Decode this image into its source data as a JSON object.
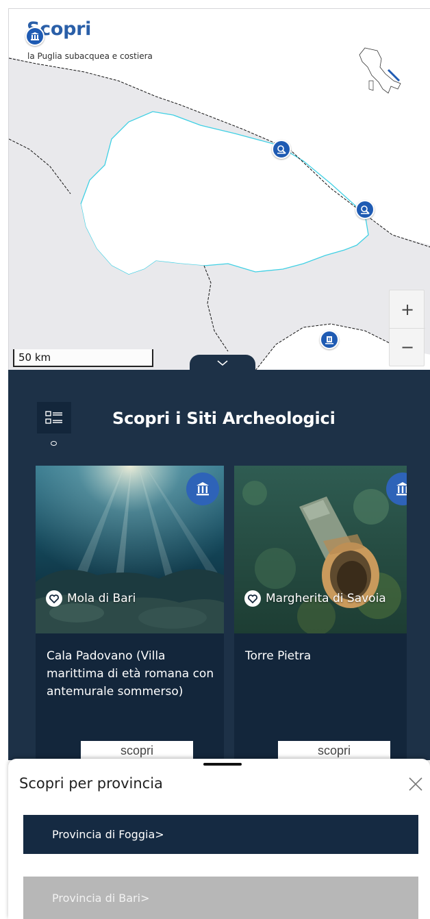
{
  "map": {
    "title": "Scopri",
    "subtitle": "la Puglia subacquea e costiera",
    "scale_label": "50 km",
    "zoom_in": "+",
    "zoom_out": "−",
    "marker_icon": "archaeology-site-icon",
    "colors": {
      "region_outline": "#3fd0e4",
      "marker": "#1f5bb3",
      "land_outside": "#e9e9ec"
    }
  },
  "panel": {
    "title": "Scopri i Siti Archeologici",
    "list_toggle_icon": "list-view-icon",
    "background": "#1d3147",
    "cards": [
      {
        "location": "Mola di Bari",
        "name": "Cala Padovano (Villa marittima di età romana con antemurale sommerso)",
        "button": "scopri",
        "badge_icon": "temple-icon"
      },
      {
        "location": "Margherita di Savoia",
        "name": "Torre Pietra",
        "button": "scopri",
        "badge_icon": "temple-icon"
      }
    ]
  },
  "sheet": {
    "title": "Scopri per provincia",
    "close_icon": "close-icon",
    "provinces": [
      {
        "label": "Provincia di Foggia>",
        "state": "active"
      },
      {
        "label": "Provincia di Bari>",
        "state": "inactive"
      }
    ]
  }
}
